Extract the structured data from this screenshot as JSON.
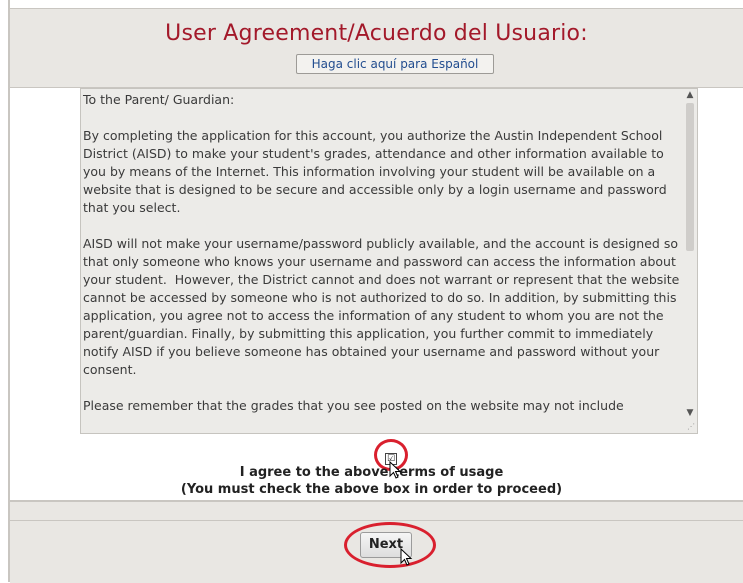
{
  "header": {
    "title": "User Agreement/Acuerdo del Usuario:",
    "spanish_link": "Haga clic aquí para Español"
  },
  "agreement": {
    "text": "To the Parent/ Guardian:\n\nBy completing the application for this account, you authorize the Austin Independent School District (AISD) to make your student's grades, attendance and other information available to you by means of the Internet. This information involving your student will be available on a website that is designed to be secure and accessible only by a login username and password that you select.\n\nAISD will not make your username/password publicly available, and the account is designed so that only someone who knows your username and password can access the information about your student.  However, the District cannot and does not warrant or represent that the website cannot be accessed by someone who is not authorized to do so. In addition, by submitting this application, you agree not to access the information of any student to whom you are not the parent/guardian. Finally, by submitting this application, you further commit to immediately notify AISD if you believe someone has obtained your username and password without your consent.\n\nPlease remember that the grades that you see posted on the website may not include"
  },
  "consent": {
    "checked_glyph": "☑",
    "label_line1": "I agree to the above terms of usage",
    "label_line2": "(You must check the above box in order to proceed)"
  },
  "footer": {
    "next_label": "Next"
  },
  "colors": {
    "title": "#a3192a",
    "highlight": "#d9202e",
    "panel": "#e9e7e3"
  }
}
